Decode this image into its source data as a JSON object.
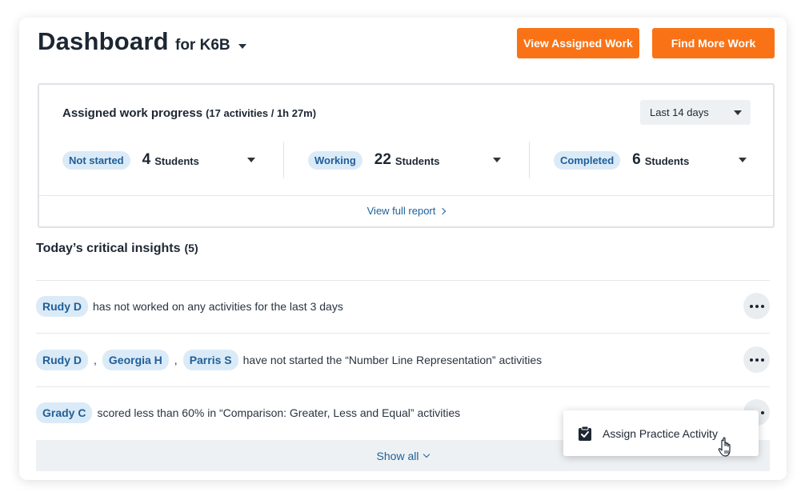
{
  "header": {
    "title": "Dashboard",
    "class_label": "for K6B",
    "buttons": {
      "view_assigned": "View Assigned Work",
      "find_more": "Find More Work"
    }
  },
  "progress": {
    "title": "Assigned work progress",
    "subtitle": "(17 activities / 1h 27m)",
    "range": "Last 14 days",
    "stats": [
      {
        "label": "Not started",
        "count": "4",
        "unit": "Students"
      },
      {
        "label": "Working",
        "count": "22",
        "unit": "Students"
      },
      {
        "label": "Completed",
        "count": "6",
        "unit": "Students"
      }
    ],
    "report_link": "View full report"
  },
  "insights": {
    "title": "Today’s critical insights",
    "count": "(5)",
    "rows": [
      {
        "names": [
          "Rudy D"
        ],
        "text": "has not worked on any activities for the last 3 days"
      },
      {
        "names": [
          "Rudy D",
          "Georgia H",
          "Parris S"
        ],
        "separator": ",",
        "text": "have not started the “Number Line Representation” activities"
      },
      {
        "names": [
          "Grady C"
        ],
        "text": "scored less than 60% in “Comparison: Greater, Less and Equal” activities"
      }
    ],
    "show_all": "Show all"
  },
  "popup": {
    "item": "Assign Practice Activity",
    "icon": "clipboard-check-icon"
  },
  "colors": {
    "accent_orange": "#f97316",
    "link_blue": "#1e5f99",
    "chip_bg": "#dbeaf7"
  }
}
